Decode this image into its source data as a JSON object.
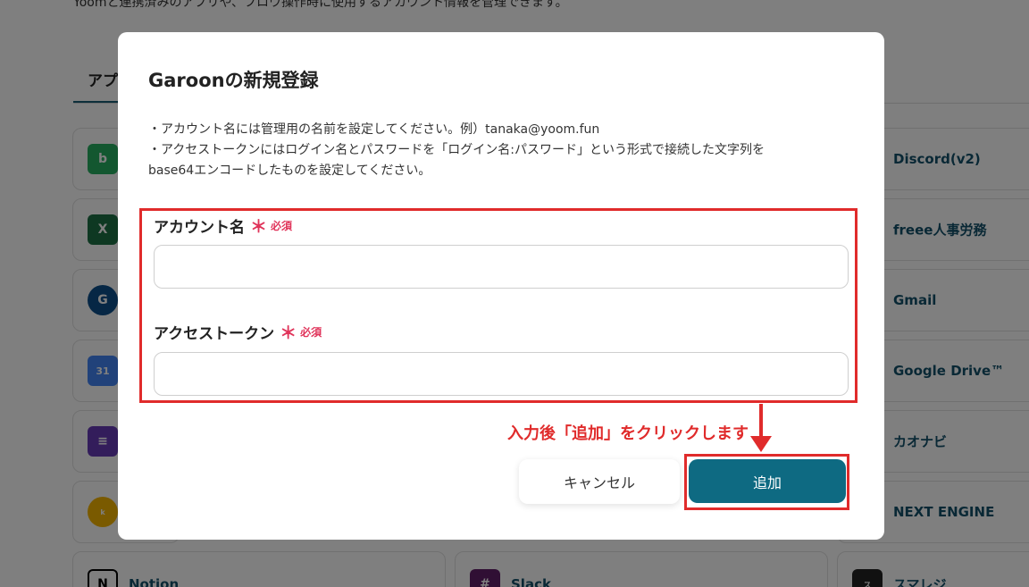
{
  "background": {
    "description": "Yoomと連携済みのアプリや、フロウ操作時に使用するアカウント情報を管理できます。",
    "tab_label": "アプ",
    "left_cards": [
      {
        "icon": "bizmail-icon",
        "label": "",
        "color": "#27ae60"
      },
      {
        "icon": "excel-icon",
        "label": "",
        "color": "#1d7044"
      },
      {
        "icon": "garoon-icon",
        "label": "",
        "color": "#0d4f8b"
      },
      {
        "icon": "google-calendar-icon",
        "label": "",
        "color": "#4285f4"
      },
      {
        "icon": "google-forms-icon",
        "label": "",
        "color": "#673ab7"
      },
      {
        "icon": "kintone-icon",
        "label": "",
        "color": "#f4b400"
      },
      {
        "icon": "notion-icon",
        "label": "Notion",
        "color": "#000000"
      }
    ],
    "middle_cards": [
      {
        "icon": "slack-icon",
        "label": "Slack",
        "color": "#611f69"
      }
    ],
    "right_cards": [
      {
        "label": "Discord(v2)"
      },
      {
        "label": "freee人事労務"
      },
      {
        "label": "Gmail"
      },
      {
        "label": "Google Drive™"
      },
      {
        "label": "カオナビ"
      },
      {
        "label": "NEXT ENGINE"
      },
      {
        "label": "スマレジ"
      }
    ]
  },
  "modal": {
    "title": "Garoonの新規登録",
    "desc_line1": "・アカウント名には管理用の名前を設定してください。例）tanaka@yoom.fun",
    "desc_line2": "・アクセストークンにはログイン名とパスワードを「ログイン名:パスワード」という形式で接続した文字列を",
    "desc_line3": "base64エンコードしたものを設定してください。",
    "fields": [
      {
        "label": "アカウント名",
        "required_mark": "＊",
        "required_text": "必須",
        "value": "",
        "placeholder": ""
      },
      {
        "label": "アクセストークン",
        "required_mark": "＊",
        "required_text": "必須",
        "value": "",
        "placeholder": ""
      }
    ],
    "annotation": "入力後「追加」をクリックします",
    "cancel_label": "キャンセル",
    "add_label": "追加"
  },
  "colors": {
    "accent": "#0e6a82",
    "highlight": "#e02b2b",
    "required": "#e0345a"
  }
}
